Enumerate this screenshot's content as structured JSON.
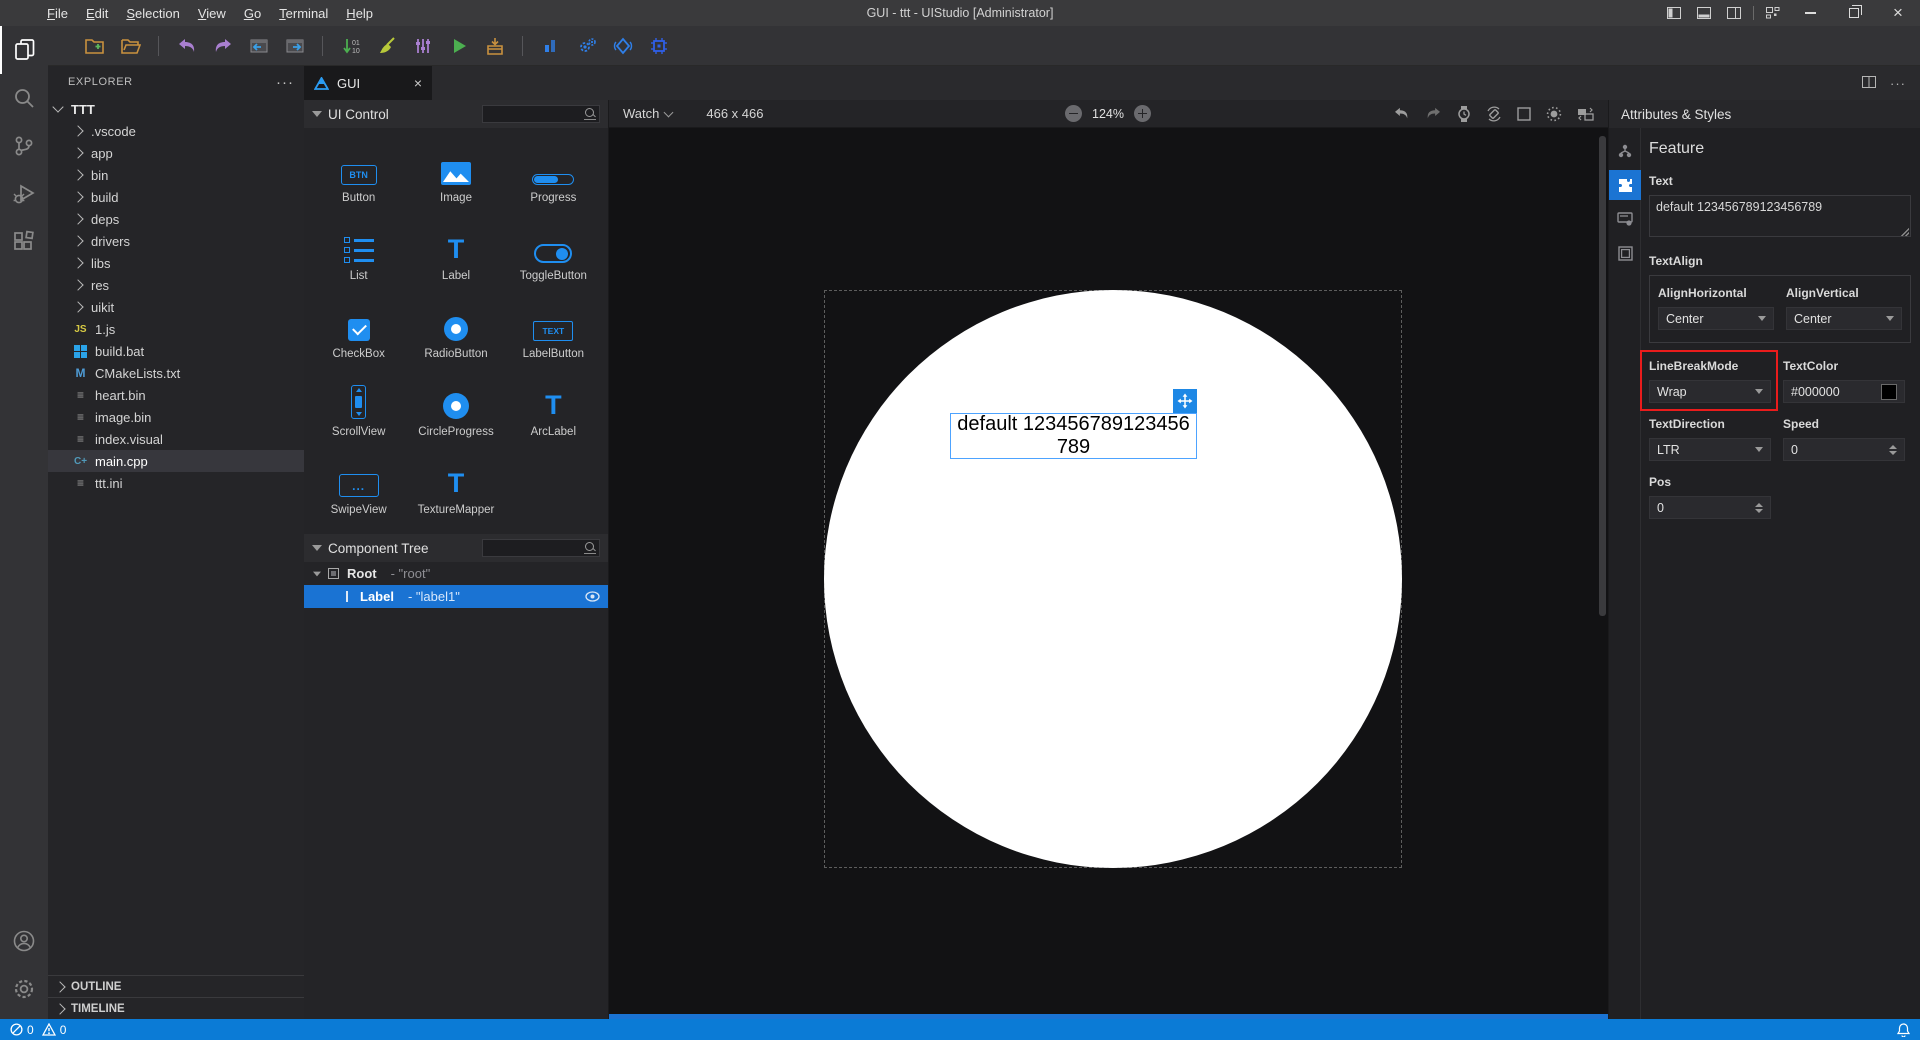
{
  "titlebar": {
    "menus": [
      "File",
      "Edit",
      "Selection",
      "View",
      "Go",
      "Terminal",
      "Help"
    ],
    "title": "GUI - ttt - UIStudio [Administrator]"
  },
  "explorer": {
    "title": "EXPLORER",
    "tree": [
      {
        "name": "TTT"
      },
      {
        "name": ".vscode"
      },
      {
        "name": "app"
      },
      {
        "name": "bin"
      },
      {
        "name": "build"
      },
      {
        "name": "deps"
      },
      {
        "name": "drivers"
      },
      {
        "name": "libs"
      },
      {
        "name": "res"
      },
      {
        "name": "uikit"
      },
      {
        "name": "1.js"
      },
      {
        "name": "build.bat"
      },
      {
        "name": "CMakeLists.txt"
      },
      {
        "name": "heart.bin"
      },
      {
        "name": "image.bin"
      },
      {
        "name": "index.visual"
      },
      {
        "name": "main.cpp"
      },
      {
        "name": "ttt.ini"
      }
    ],
    "file_icon_texts": {
      "js": "JS",
      "cmake": "M",
      "lines": "≡",
      "cpp": "C+"
    },
    "bottom_sections": {
      "outline": "OUTLINE",
      "timeline": "TIMELINE"
    }
  },
  "tabs": {
    "active_label": "GUI",
    "close_glyph": "×"
  },
  "ui_control": {
    "title": "UI Control",
    "items": [
      {
        "label": "Button"
      },
      {
        "label": "Image"
      },
      {
        "label": "Progress"
      },
      {
        "label": "List"
      },
      {
        "label": "Label"
      },
      {
        "label": "ToggleButton"
      },
      {
        "label": "CheckBox"
      },
      {
        "label": "RadioButton"
      },
      {
        "label": "LabelButton"
      },
      {
        "label": "ScrollView"
      },
      {
        "label": "CircleProgress"
      },
      {
        "label": "ArcLabel"
      },
      {
        "label": "SwipeView"
      },
      {
        "label": "TextureMapper"
      }
    ],
    "icon_texts": {
      "button": "BTN",
      "label": "T",
      "labelbutton": "TEXT",
      "arclabel": "T",
      "swipeview": "...",
      "texturemapper": "T"
    }
  },
  "component_tree": {
    "title": "Component Tree",
    "rows": [
      {
        "type": "Root",
        "suffix": "- \"root\""
      },
      {
        "type": "Label",
        "suffix": "- \"label1\""
      }
    ]
  },
  "canvas": {
    "device": "Watch",
    "size": "466 x 466",
    "zoom": "124%",
    "label_line1": "default 123456789123456",
    "label_line2": "789"
  },
  "attributes": {
    "title": "Attributes & Styles",
    "section_title": "Feature",
    "text": {
      "label": "Text",
      "value": "default 123456789123456789"
    },
    "textalign": {
      "label": "TextAlign",
      "align_horizontal": {
        "label": "AlignHorizontal",
        "value": "Center"
      },
      "align_vertical": {
        "label": "AlignVertical",
        "value": "Center"
      }
    },
    "linebreak": {
      "label": "LineBreakMode",
      "value": "Wrap"
    },
    "textcolor": {
      "label": "TextColor",
      "value": "#000000"
    },
    "textdirection": {
      "label": "TextDirection",
      "value": "LTR"
    },
    "speed": {
      "label": "Speed",
      "value": "0"
    },
    "pos": {
      "label": "Pos",
      "value": "0"
    }
  },
  "statusbar": {
    "errors": "0",
    "warnings": "0"
  },
  "colors": {
    "accent_blue": "#1f8ef0",
    "selection_blue": "#1a73d3",
    "status_bar": "#0b7bd6",
    "highlight_red": "#ea1c1c",
    "text_color_swatch": "#000000",
    "canvas_face": "#ffffff"
  }
}
